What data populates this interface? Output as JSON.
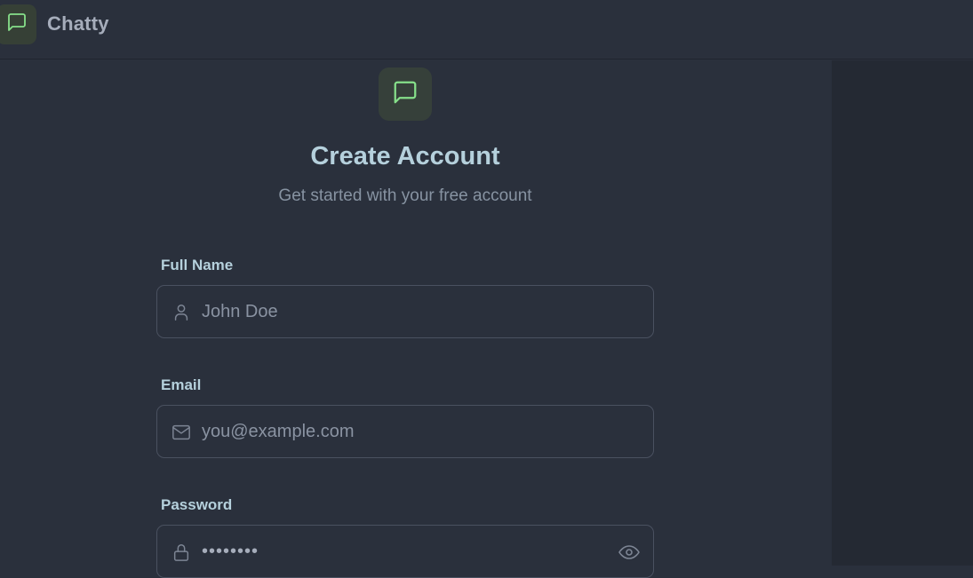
{
  "app": {
    "name": "Chatty",
    "brand_icon": "message-square-icon",
    "accent_color": "#86e08a"
  },
  "form": {
    "title": "Create Account",
    "subtitle": "Get started with your free account",
    "full_name": {
      "label": "Full Name",
      "placeholder": "John Doe",
      "value": "",
      "icon": "user-icon"
    },
    "email": {
      "label": "Email",
      "placeholder": "you@example.com",
      "value": "",
      "icon": "mail-icon"
    },
    "password": {
      "label": "Password",
      "placeholder": "",
      "value": "••••••••",
      "icon": "lock-icon",
      "toggle_icon": "eye-icon"
    }
  }
}
